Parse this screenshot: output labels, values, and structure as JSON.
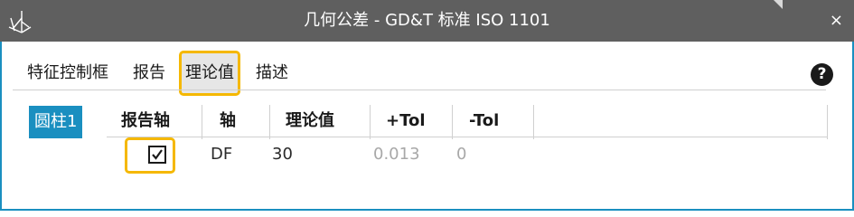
{
  "window": {
    "title": "几何公差 - GD&T 标准 ISO 1101",
    "close_label": "×"
  },
  "tabs": [
    {
      "label": "特征控制框",
      "active": false
    },
    {
      "label": "报告",
      "active": false
    },
    {
      "label": "理论值",
      "active": true
    },
    {
      "label": "描述",
      "active": false
    }
  ],
  "help_label": "?",
  "feature": {
    "label": "圆柱1"
  },
  "table": {
    "columns": [
      "报告轴",
      "轴",
      "理论值",
      "+Tol",
      "-Tol"
    ],
    "rows": [
      {
        "report_axis": true,
        "axis": "DF",
        "nominal": "30",
        "plus_tol": "0.013",
        "minus_tol": "0"
      }
    ]
  },
  "colors": {
    "accent": "#1a8fc0",
    "highlight": "#f5b800",
    "titlebar": "#5f5f5f"
  }
}
